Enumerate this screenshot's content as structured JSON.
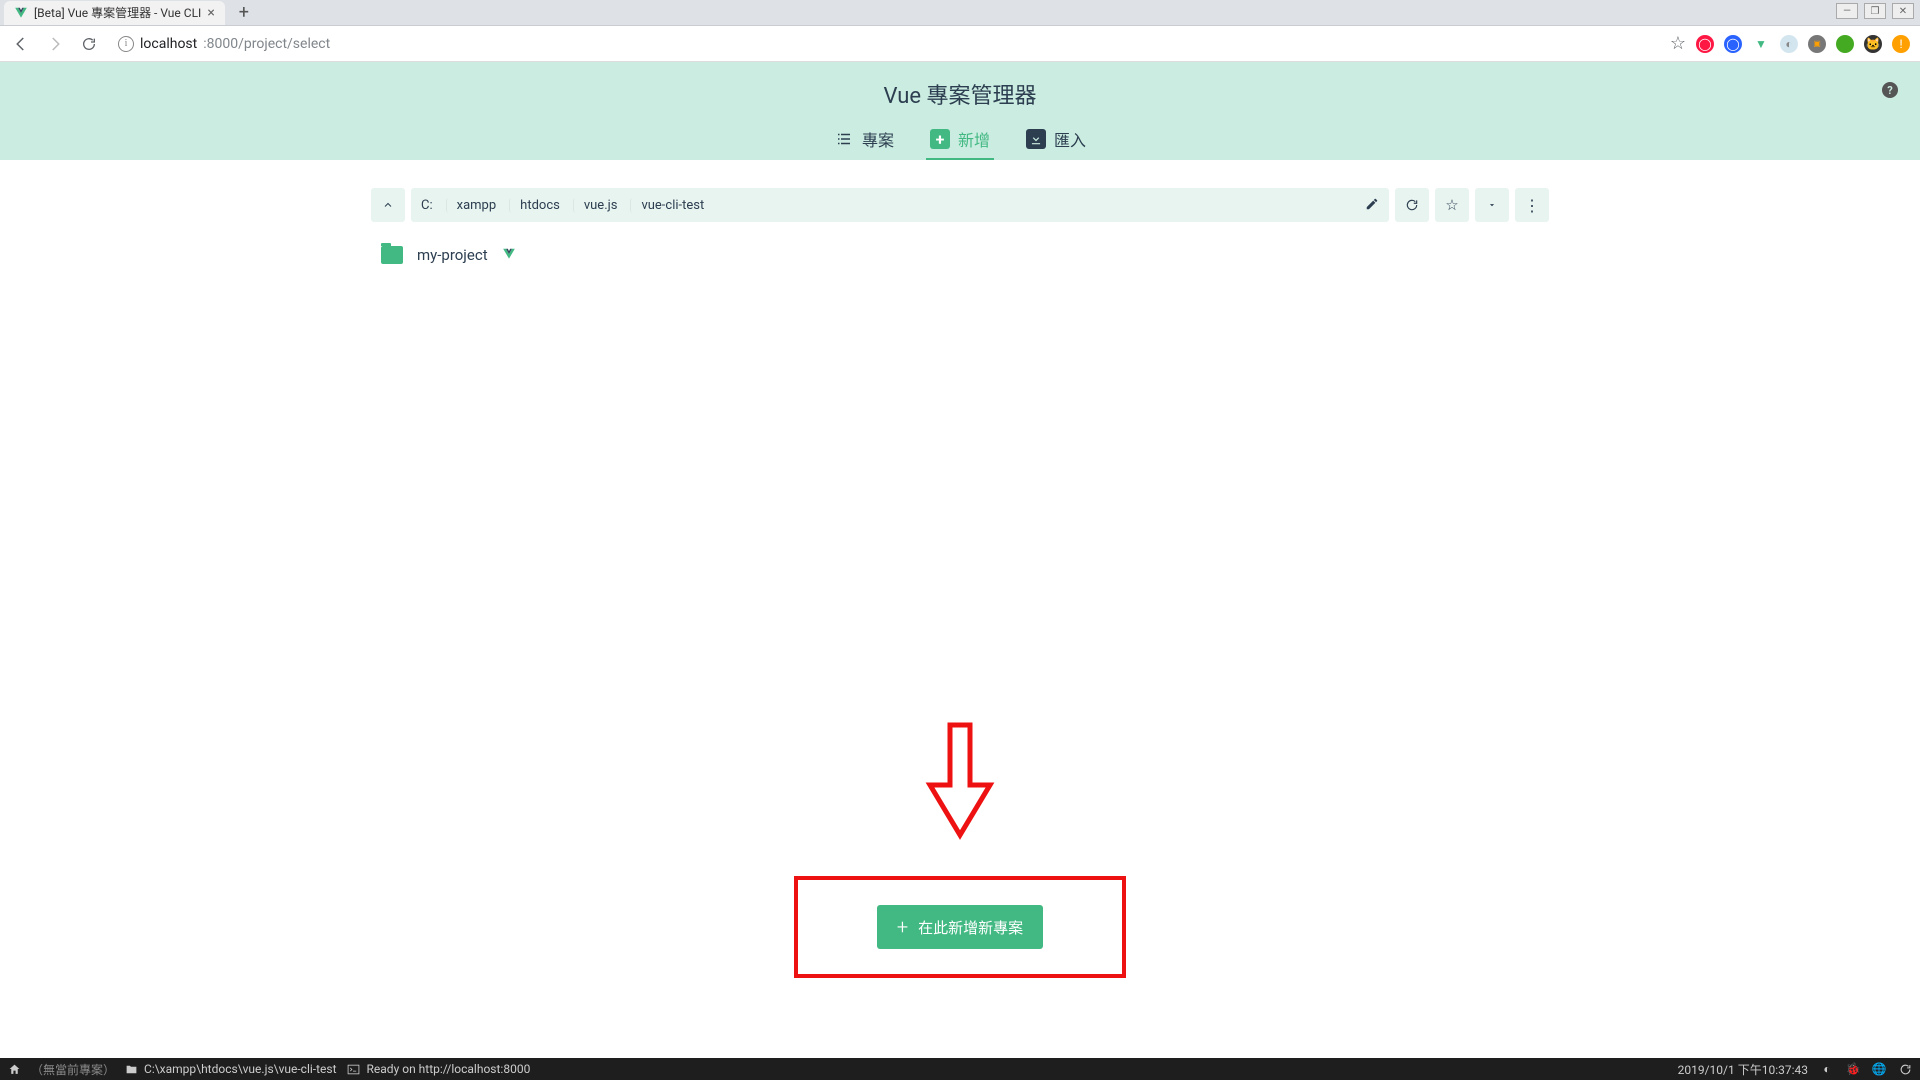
{
  "window": {
    "tab_title": "[Beta] Vue 專案管理器 - Vue CLI",
    "url_host": "localhost",
    "url_port_path": ":8000/project/select"
  },
  "header": {
    "title": "Vue 專案管理器",
    "tabs": {
      "projects": "專案",
      "create": "新增",
      "import": "匯入"
    }
  },
  "path": {
    "segments": [
      "C:",
      "xampp",
      "htdocs",
      "vue.js",
      "vue-cli-test"
    ]
  },
  "folders": [
    {
      "name": "my-project",
      "is_vue": true
    }
  ],
  "create_button": "在此新增新專案",
  "status": {
    "no_project": "（無當前專案）",
    "cwd": "C:\\xampp\\htdocs\\vue.js\\vue-cli-test",
    "ready": "Ready on http://localhost:8000",
    "timestamp": "2019/10/1 下午10:37:43"
  }
}
